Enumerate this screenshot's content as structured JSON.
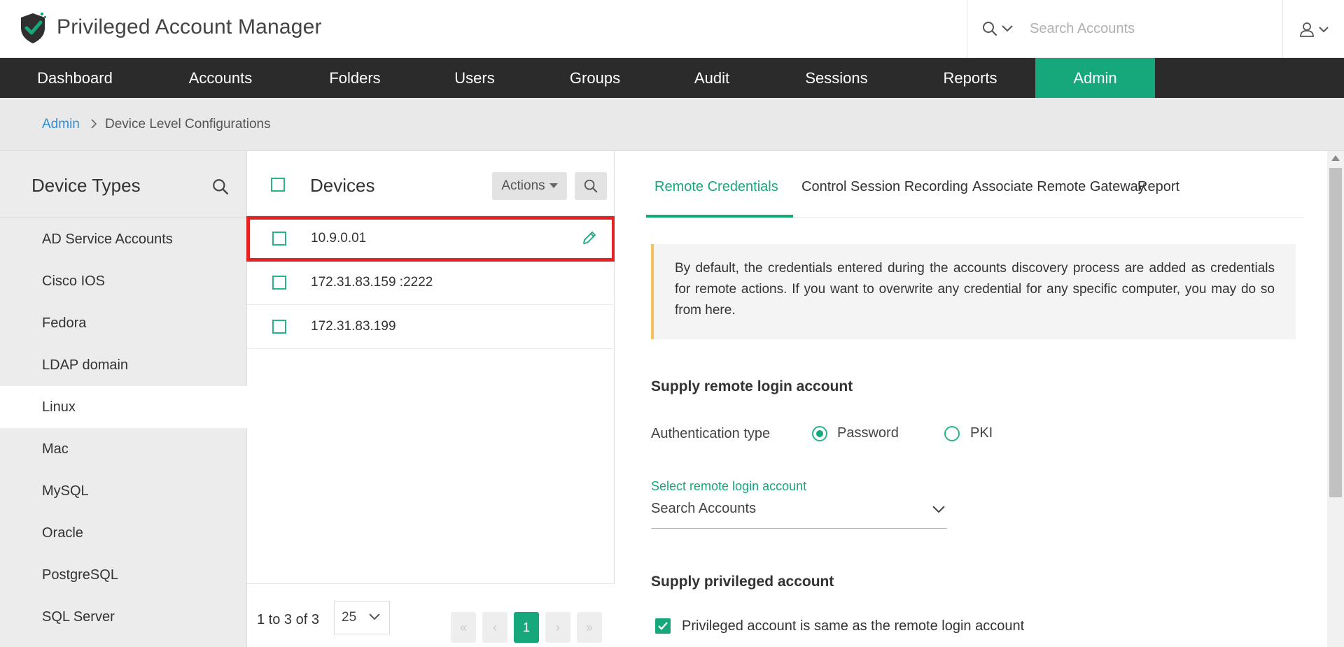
{
  "header": {
    "app_title": "Privileged Account Manager",
    "search_placeholder": "Search Accounts"
  },
  "nav": {
    "items": [
      {
        "label": "Dashboard"
      },
      {
        "label": "Accounts"
      },
      {
        "label": "Folders"
      },
      {
        "label": "Users"
      },
      {
        "label": "Groups"
      },
      {
        "label": "Audit"
      },
      {
        "label": "Sessions"
      },
      {
        "label": "Reports"
      },
      {
        "label": "Admin",
        "active": true
      }
    ]
  },
  "breadcrumb": {
    "root": "Admin",
    "current": "Device Level Configurations"
  },
  "device_types": {
    "title": "Device Types",
    "items": [
      "AD Service Accounts",
      "Cisco IOS",
      "Fedora",
      "LDAP domain",
      "Linux",
      "Mac",
      "MySQL",
      "Oracle",
      "PostgreSQL",
      "SQL Server"
    ],
    "selected": "Linux"
  },
  "devices": {
    "title": "Devices",
    "actions_label": "Actions",
    "rows": [
      {
        "label": "10.9.0.01",
        "highlighted": true
      },
      {
        "label": "172.31.83.159 :2222"
      },
      {
        "label": "172.31.83.199"
      }
    ],
    "pagination": {
      "info": "1 to 3 of 3",
      "page_size": "25",
      "current_page": "1"
    }
  },
  "right_panel": {
    "tabs": [
      {
        "label": "Remote Credentials",
        "active": true
      },
      {
        "label": "Control Session Recording"
      },
      {
        "label": "Associate Remote Gateway"
      },
      {
        "label": "Report"
      }
    ],
    "info_text": "By default, the credentials entered during the accounts discovery process are added as credentials for remote actions. If you want to overwrite any credential for any specific computer, you may do so from here.",
    "remote_login_title": "Supply remote login account",
    "auth_type_label": "Authentication type",
    "auth_options": {
      "password": "Password",
      "pki": "PKI"
    },
    "auth_selected": "Password",
    "select_account_label": "Select remote login account",
    "select_account_value": "Search Accounts",
    "privileged_title": "Supply privileged account",
    "privileged_same_label": "Privileged account is same as the remote login account",
    "privileged_same_checked": true
  },
  "colors": {
    "accent": "#16a77b",
    "nav_bg": "#2b2b2b",
    "highlight": "#e52222",
    "link": "#2d8fd8",
    "info_border": "#f6c15a"
  }
}
